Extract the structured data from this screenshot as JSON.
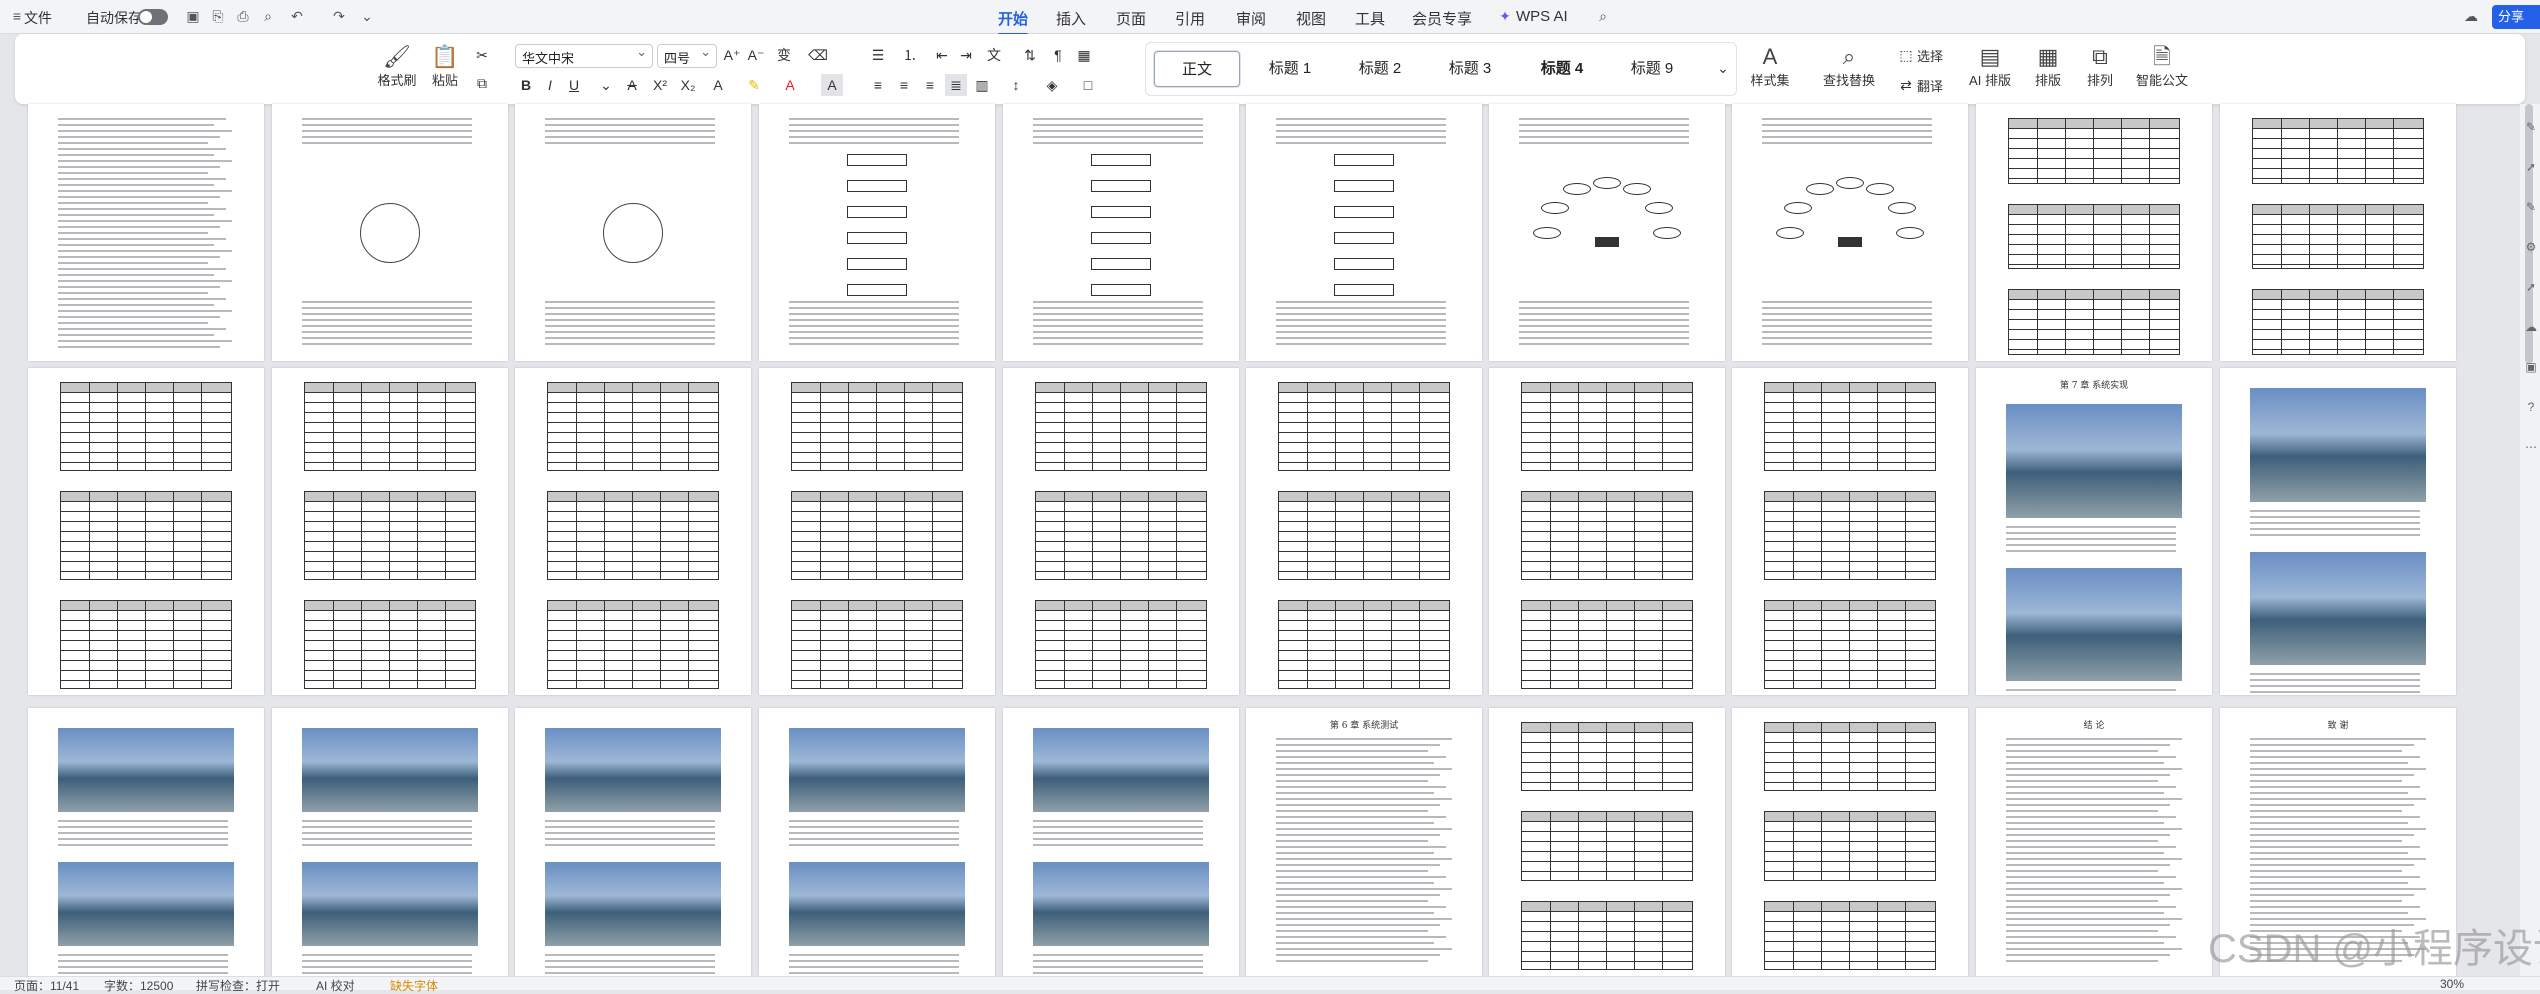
{
  "titlebar": {
    "file": "文件",
    "autosave": "自动保存",
    "tabs": [
      "开始",
      "插入",
      "页面",
      "引用",
      "审阅",
      "视图",
      "工具",
      "会员专享"
    ],
    "ai": "WPS AI",
    "share": "分享"
  },
  "ribbon": {
    "format_painter": "格式刷",
    "paste": "粘贴",
    "font": "华文中宋",
    "size": "四号",
    "styles": [
      "正文",
      "标题 1",
      "标题 2",
      "标题 3",
      "标题 4",
      "标题 9"
    ],
    "style_set": "样式集",
    "find_replace": "查找替换",
    "select": "选择",
    "translate": "翻译",
    "ai_layout": "AI 排版",
    "layout": "排版",
    "arrange": "排列",
    "smart_doc": "智能公文"
  },
  "document": {
    "chapter_heading": "第 7 章 系统实现",
    "chapter_heading_2": "第 6 章 系统测试",
    "closing_title": "结  论",
    "thanks_title": "致  谢"
  },
  "status": {
    "page": "页面：11/41",
    "words": "字数：12500",
    "spell": "拼写检查：打开",
    "proof": "AI 校对",
    "missing_font": "缺失字体",
    "zoom": "30%"
  },
  "watermark": "CSDN @小程序设计",
  "colors": {
    "accent": "#2561e8",
    "share_bg": "#2561e8"
  }
}
